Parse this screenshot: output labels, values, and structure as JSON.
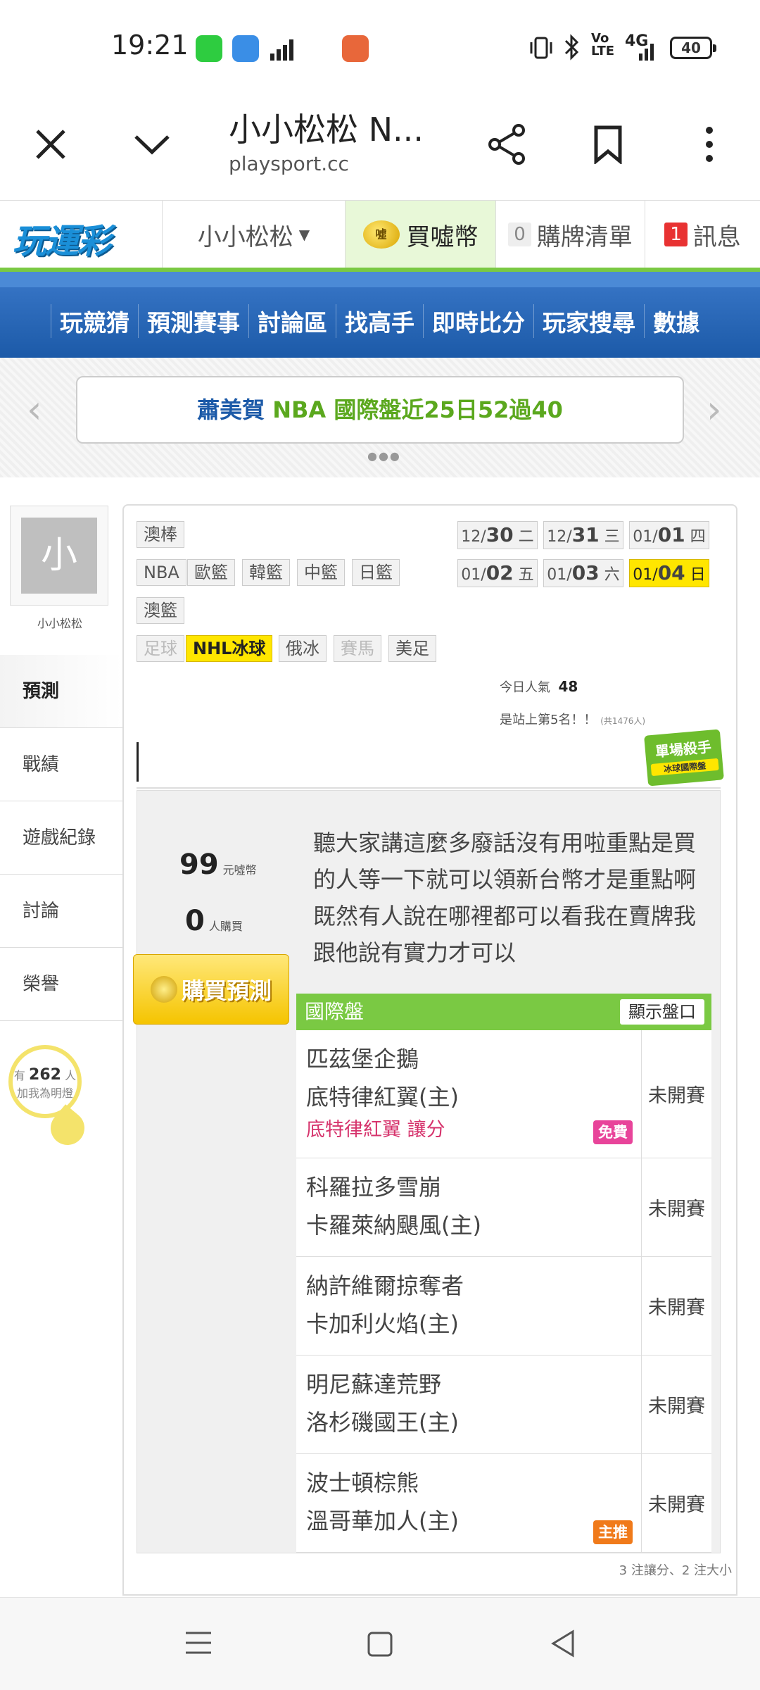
{
  "status_bar": {
    "time": "19:21",
    "network": "4G",
    "battery": "40",
    "app_colors": [
      "#2ecc40",
      "#3a8ee6",
      "#e8673a"
    ]
  },
  "browser": {
    "title": "小小松松 N...",
    "url": "playsport.cc"
  },
  "site_header": {
    "logo": "玩運彩",
    "user_menu": "小小松松",
    "buy_coins": "買噓幣",
    "cart_count": "0",
    "cart_label": "購牌清單",
    "msg_count": "1",
    "msg_label": "訊息",
    "coin_icon_text": "噓"
  },
  "nav": {
    "items": [
      "玩競猜",
      "預測賽事",
      "討論區",
      "找高手",
      "即時比分",
      "玩家搜尋",
      "數據"
    ]
  },
  "banner": {
    "name": "蕭美賀",
    "league": "NBA",
    "rest": "國際盤近25日52過40"
  },
  "profile": {
    "avatar_char": "小",
    "name": "小小松松"
  },
  "side_tabs": [
    "預測",
    "戰績",
    "遊戲紀錄",
    "討論",
    "榮譽"
  ],
  "fans": {
    "prefix": "有",
    "count": "262",
    "suffix": "人",
    "line2": "加我為明燈"
  },
  "leagues": {
    "row1": [
      "澳棒"
    ],
    "row2": [
      "NBA",
      "歐籃",
      "韓籃",
      "中籃",
      "日籃"
    ],
    "row3": [
      "澳籃"
    ],
    "row4": [
      "足球",
      "NHL冰球",
      "俄冰",
      "賽馬",
      "美足"
    ]
  },
  "dates": [
    {
      "md": "12/",
      "d": "30",
      "wd": "二"
    },
    {
      "md": "12/",
      "d": "31",
      "wd": "三"
    },
    {
      "md": "01/",
      "d": "01",
      "wd": "四"
    },
    {
      "md": "01/",
      "d": "02",
      "wd": "五"
    },
    {
      "md": "01/",
      "d": "03",
      "wd": "六"
    },
    {
      "md": "01/",
      "d": "04",
      "wd": "日"
    }
  ],
  "popularity": {
    "label": "今日人氣",
    "value": "48",
    "rank": "是站上第5名！！",
    "total": "(共1476人)"
  },
  "badge": {
    "title": "單場殺手",
    "sub": "冰球國際盤"
  },
  "purchase": {
    "price": "99",
    "price_unit": "元噓幣",
    "buyers": "0",
    "buyers_unit": "人購買",
    "button": "購買預測"
  },
  "description": "聽大家講這麼多廢話沒有用啦重點是買的人等一下就可以領新台幣才是重點啊既然有人說在哪裡都可以看我在賣牌我跟他說有實力才可以",
  "picks": {
    "header": "國際盤",
    "show_button": "顯示盤口",
    "rows": [
      {
        "away": "匹茲堡企鵝",
        "home": "底特律紅翼(主)",
        "pick": "底特律紅翼 讓分",
        "status": "未開賽",
        "tag": "免費"
      },
      {
        "away": "科羅拉多雪崩",
        "home": "卡羅萊納颶風(主)",
        "status": "未開賽"
      },
      {
        "away": "納許維爾掠奪者",
        "home": "卡加利火焰(主)",
        "status": "未開賽"
      },
      {
        "away": "明尼蘇達荒野",
        "home": "洛杉磯國王(主)",
        "status": "未開賽"
      },
      {
        "away": "波士頓棕熊",
        "home": "溫哥華加人(主)",
        "status": "未開賽",
        "tag": "主推"
      }
    ],
    "footnote": "3 注讓分、2 注大小"
  },
  "colors": {
    "brand_green": "#7ac943",
    "nav_blue": "#1c5aa8",
    "highlight_yellow": "#ffe600",
    "free_tag": "#e8449a",
    "main_tag": "#f07a1a"
  }
}
